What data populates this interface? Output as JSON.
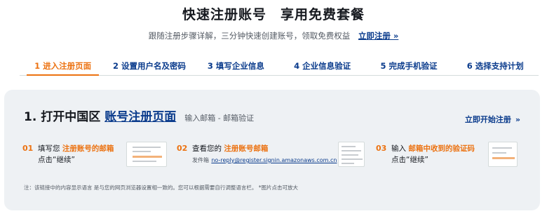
{
  "header": {
    "title": "快速注册账号　享用免费套餐",
    "subtitle": "跟随注册步骤详解，三分钟快速创建账号，领取免费权益",
    "register_link": "立即注册 »"
  },
  "steps": [
    {
      "label": "1 进入注册页面",
      "active": true
    },
    {
      "label": "2 设置用户名及密码",
      "active": false
    },
    {
      "label": "3 填写企业信息",
      "active": false
    },
    {
      "label": "4 企业信息验证",
      "active": false
    },
    {
      "label": "5 完成手机验证",
      "active": false
    },
    {
      "label": "6 选择支持计划",
      "active": false
    }
  ],
  "section": {
    "number": "1. 打开中国区",
    "link": "账号注册页面",
    "sub": "输入邮箱 - 邮箱验证",
    "start_label": "立即开始注册",
    "start_chevron": "»"
  },
  "substeps": [
    {
      "num": "01",
      "pre": "填写您",
      "highlight": "注册账号的邮箱",
      "line2": "点击“继续”"
    },
    {
      "num": "02",
      "pre": "查看您的",
      "highlight": "注册账号邮箱",
      "sender_label": "发件箱",
      "sender_email": "no-reply@register.signin.amazonaws.com.cn"
    },
    {
      "num": "03",
      "pre": "输入",
      "highlight": "邮箱中收到的验证码",
      "line2": "点击“继续”"
    }
  ],
  "note": "注：该链接中的内容显示语言 是与您的网页浏览器设置相一致的。您可以根据需要自行调整语言栏。 *图片点击可放大",
  "colors": {
    "accent": "#ec7211",
    "link": "#0a3b8c",
    "panel": "#eef1f4"
  }
}
